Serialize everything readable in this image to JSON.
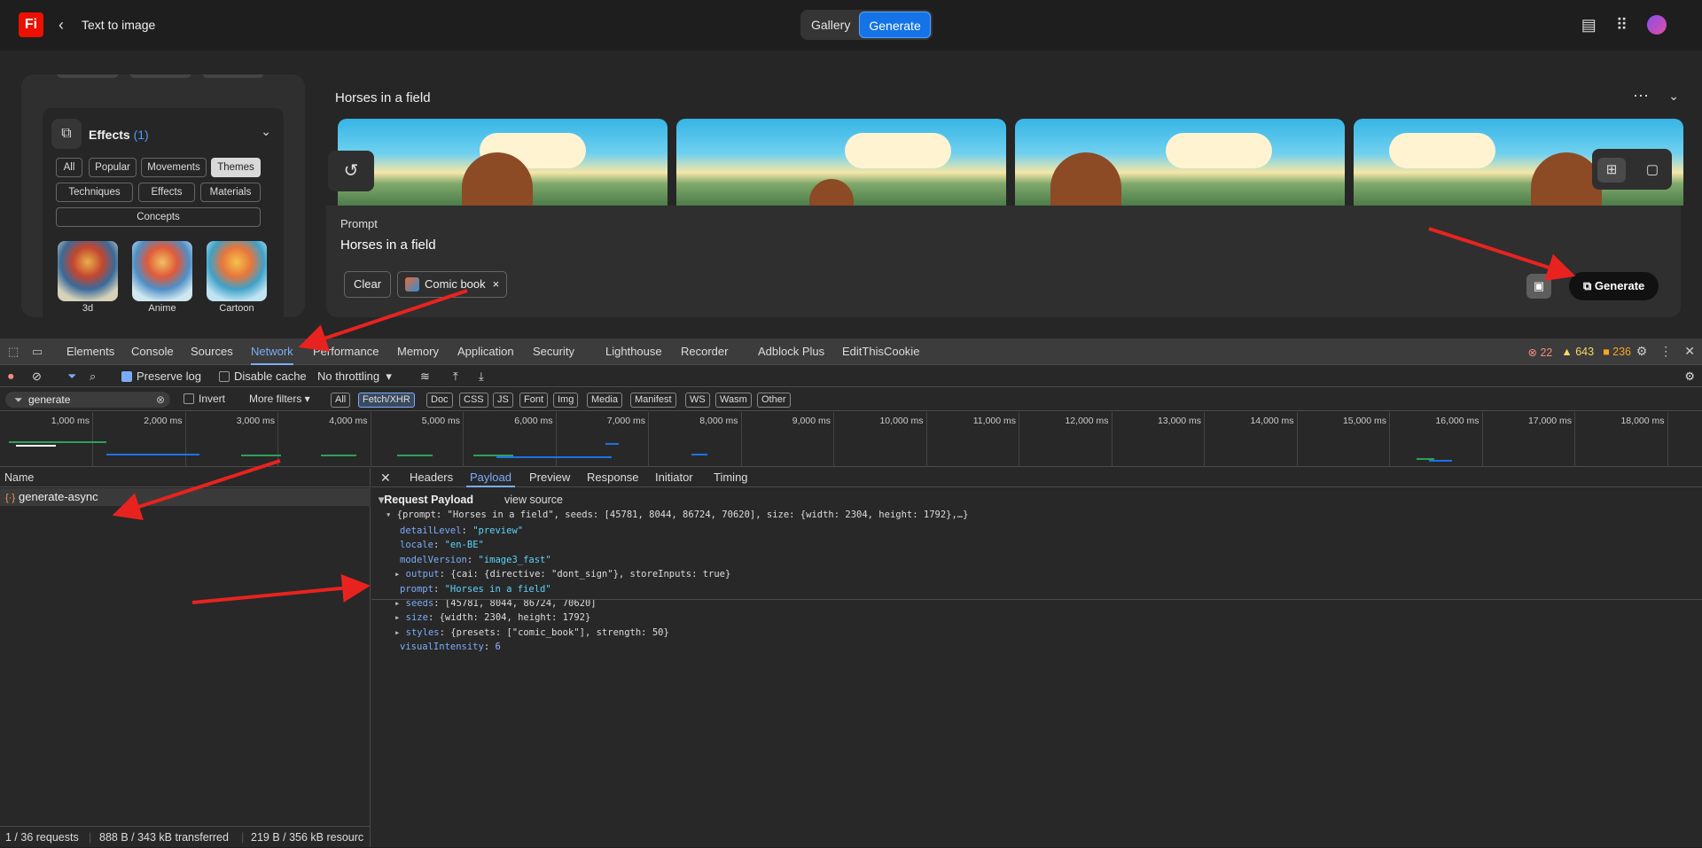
{
  "app": {
    "logo_text": "Fi",
    "title": "Text to image",
    "segments": [
      "Gallery",
      "Generate"
    ],
    "active_segment": "Generate"
  },
  "effects": {
    "title": "Effects",
    "count": "(1)",
    "chips": [
      "All",
      "Popular",
      "Movements",
      "Themes",
      "Techniques",
      "Effects",
      "Materials",
      "Concepts"
    ],
    "selected_chip": "Themes",
    "styles": [
      "3d",
      "Anime",
      "Cartoon"
    ]
  },
  "gallery": {
    "title": "Horses in a field"
  },
  "prompt": {
    "label": "Prompt",
    "text": "Horses in a field",
    "clear_label": "Clear",
    "tag_label": "Comic book",
    "generate_label": "Generate"
  },
  "devtools": {
    "tabs": [
      "Elements",
      "Console",
      "Sources",
      "Network",
      "Performance",
      "Memory",
      "Application",
      "Security",
      "Lighthouse",
      "Recorder",
      "Adblock Plus",
      "EditThisCookie"
    ],
    "active_tab": "Network",
    "errors": "22",
    "warnings": "643",
    "issues": "236",
    "preserve_log": "Preserve log",
    "disable_cache": "Disable cache",
    "throttling": "No throttling",
    "filter_value": "generate",
    "invert": "Invert",
    "more_filters": "More filters",
    "type_filters": [
      "All",
      "Fetch/XHR",
      "Doc",
      "CSS",
      "JS",
      "Font",
      "Img",
      "Media",
      "Manifest",
      "WS",
      "Wasm",
      "Other"
    ],
    "active_type": "Fetch/XHR",
    "timeline_ticks": [
      "1,000 ms",
      "2,000 ms",
      "3,000 ms",
      "4,000 ms",
      "5,000 ms",
      "6,000 ms",
      "7,000 ms",
      "8,000 ms",
      "9,000 ms",
      "10,000 ms",
      "11,000 ms",
      "12,000 ms",
      "13,000 ms",
      "14,000 ms",
      "15,000 ms",
      "16,000 ms",
      "17,000 ms",
      "18,000 ms"
    ],
    "name_header": "Name",
    "request_name": "generate-async",
    "status_requests": "1 / 36 requests",
    "status_transferred": "888 B / 343 kB transferred",
    "status_resources": "219 B / 356 kB resourc",
    "detail_tabs": [
      "Headers",
      "Payload",
      "Preview",
      "Response",
      "Initiator",
      "Timing"
    ],
    "active_detail_tab": "Payload",
    "request_payload_label": "Request Payload",
    "view_source": "view source",
    "payload_summary": "{prompt: \"Horses in a field\", seeds: [45781, 8044, 86724, 70620], size: {width: 2304, height: 1792},…}",
    "payload_lines": [
      {
        "key": "detailLevel",
        "value": "\"preview\"",
        "expandable": false,
        "kind": "string"
      },
      {
        "key": "locale",
        "value": "\"en-BE\"",
        "expandable": false,
        "kind": "string"
      },
      {
        "key": "modelVersion",
        "value": "\"image3_fast\"",
        "expandable": false,
        "kind": "string"
      },
      {
        "key": "output",
        "value": "{cai: {directive: \"dont_sign\"}, storeInputs: true}",
        "expandable": true,
        "kind": "object"
      },
      {
        "key": "prompt",
        "value": "\"Horses in a field\"",
        "expandable": false,
        "kind": "string"
      },
      {
        "key": "seeds",
        "value": "[45781, 8044, 86724, 70620]",
        "expandable": true,
        "kind": "object"
      },
      {
        "key": "size",
        "value": "{width: 2304, height: 1792}",
        "expandable": true,
        "kind": "object"
      },
      {
        "key": "styles",
        "value": "{presets: [\"comic_book\"], strength: 50}",
        "expandable": true,
        "kind": "object"
      },
      {
        "key": "visualIntensity",
        "value": "6",
        "expandable": false,
        "kind": "number"
      }
    ]
  },
  "colors": {
    "accent": "#1473e6",
    "devtools_active": "#7cacf8",
    "annotation_arrow": "#e8231f"
  }
}
